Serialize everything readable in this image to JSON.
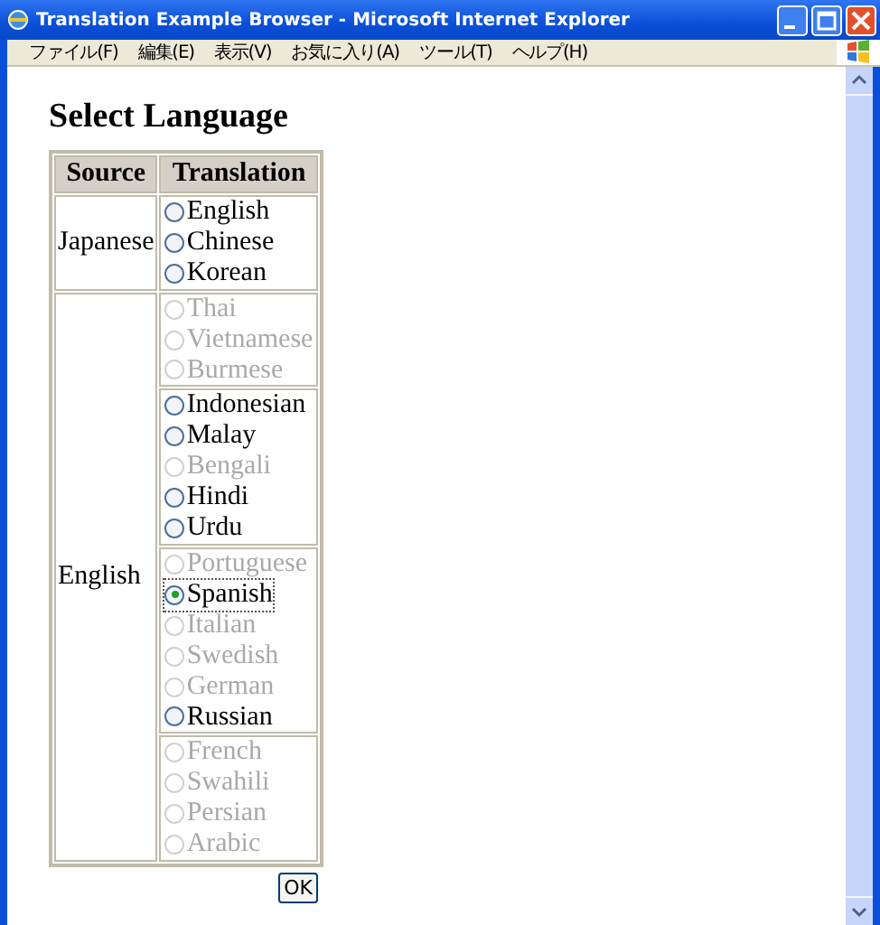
{
  "window": {
    "title": "Translation Example Browser - Microsoft Internet Explorer"
  },
  "menu": [
    "ファイル(F)",
    "編集(E)",
    "表示(V)",
    "お気に入り(A)",
    "ツール(T)",
    "ヘルプ(H)"
  ],
  "heading": "Select Language",
  "table": {
    "columns": [
      "Source",
      "Translation"
    ],
    "rows": [
      {
        "source": "Japanese",
        "groups": [
          [
            {
              "label": "English",
              "disabled": false,
              "selected": false
            },
            {
              "label": "Chinese",
              "disabled": false,
              "selected": false
            },
            {
              "label": "Korean",
              "disabled": false,
              "selected": false
            }
          ]
        ]
      },
      {
        "source": "English",
        "groups": [
          [
            {
              "label": "Thai",
              "disabled": true,
              "selected": false
            },
            {
              "label": "Vietnamese",
              "disabled": true,
              "selected": false
            },
            {
              "label": "Burmese",
              "disabled": true,
              "selected": false
            }
          ],
          [
            {
              "label": "Indonesian",
              "disabled": false,
              "selected": false
            },
            {
              "label": "Malay",
              "disabled": false,
              "selected": false
            },
            {
              "label": "Bengali",
              "disabled": true,
              "selected": false
            },
            {
              "label": "Hindi",
              "disabled": false,
              "selected": false
            },
            {
              "label": "Urdu",
              "disabled": false,
              "selected": false
            }
          ],
          [
            {
              "label": "Portuguese",
              "disabled": true,
              "selected": false
            },
            {
              "label": "Spanish",
              "disabled": false,
              "selected": true
            },
            {
              "label": "Italian",
              "disabled": true,
              "selected": false
            },
            {
              "label": "Swedish",
              "disabled": true,
              "selected": false
            },
            {
              "label": "German",
              "disabled": true,
              "selected": false
            },
            {
              "label": "Russian",
              "disabled": false,
              "selected": false
            }
          ],
          [
            {
              "label": "French",
              "disabled": true,
              "selected": false
            },
            {
              "label": "Swahili",
              "disabled": true,
              "selected": false
            },
            {
              "label": "Persian",
              "disabled": true,
              "selected": false
            },
            {
              "label": "Arabic",
              "disabled": true,
              "selected": false
            }
          ]
        ]
      }
    ]
  },
  "ok_button": "OK"
}
